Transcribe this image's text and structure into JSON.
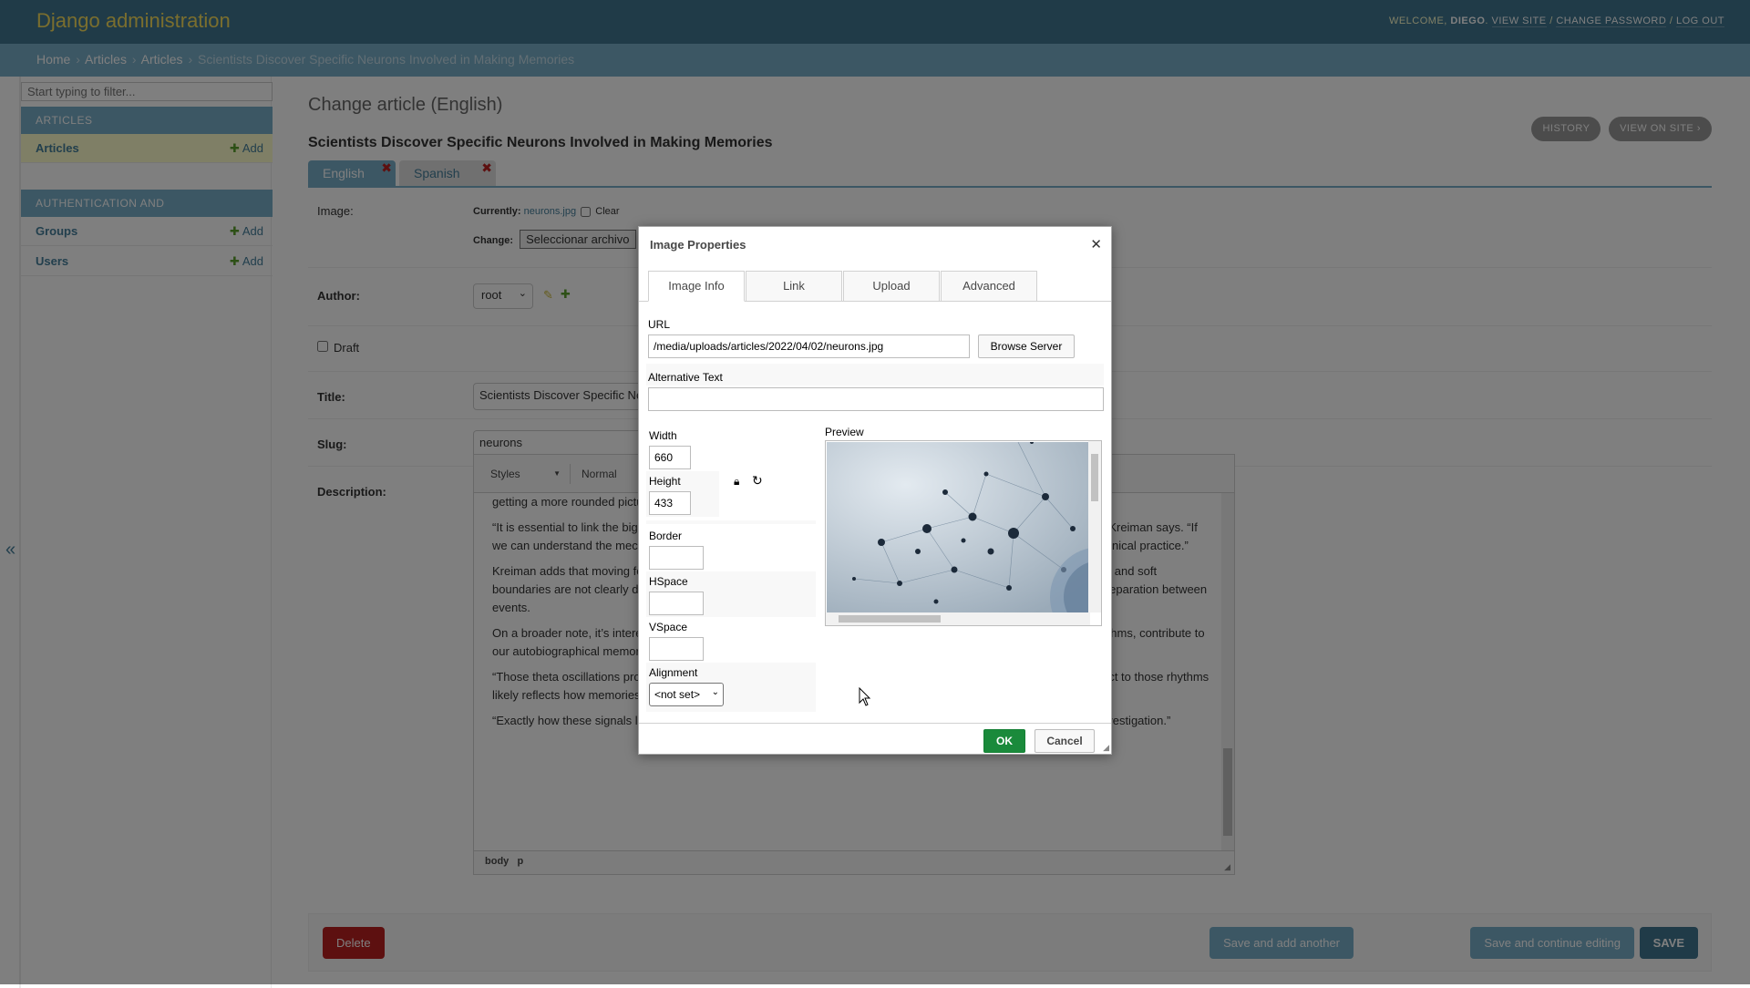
{
  "header": {
    "branding": "Django administration",
    "welcome": "Welcome,",
    "username": "Diego",
    "view_site": "View site",
    "change_password": "Change password",
    "log_out": "Log out",
    "sep": "/"
  },
  "breadcrumbs": [
    "Home",
    "Articles",
    "Articles",
    "Scientists Discover Specific Neurons Involved in Making Memories"
  ],
  "sidebar": {
    "filter_placeholder": "Start typing to filter...",
    "modules": [
      {
        "caption": "Articles",
        "items": [
          {
            "label": "Articles",
            "add": "Add"
          }
        ]
      },
      {
        "caption": "Authentication and Authorization",
        "items": [
          {
            "label": "Groups",
            "add": "Add"
          },
          {
            "label": "Users",
            "add": "Add"
          }
        ]
      }
    ],
    "toggle": "«"
  },
  "page": {
    "title": "Change article (English)",
    "object_title": "Scientists Discover Specific Neurons Involved in Making Memories",
    "history": "History",
    "view_on_site": "View on site",
    "tabs": [
      {
        "label": "English",
        "remove": "✖"
      },
      {
        "label": "Spanish",
        "remove": "✖"
      }
    ]
  },
  "form": {
    "image_label": "Image:",
    "currently": "Currently:",
    "current_file": "neurons.jpg",
    "clear": "Clear",
    "change": "Change:",
    "choose_file": "Seleccionar archivo",
    "author_label": "Author:",
    "author_value": "root",
    "draft_label": "Draft",
    "title_label": "Title:",
    "title_value": "Scientists Discover Specific Neurons Involved in Making Memories",
    "slug_label": "Slug:",
    "slug_value": "neurons",
    "description_label": "Description:"
  },
  "editor": {
    "styles": "Styles",
    "format": "Normal",
    "paragraphs": [
      "getting a more rounded picture of how memories are formed.",
      "“It is essential to link the big picture of memories with mechanisms that reveal what is happening at the cellular level,” Kreiman says. “If we can understand the mechanisms, we can hopefully help people with memory deficits, bridging neuroscience and clinical practice.”",
      "Kreiman adds that moving forward, it will be important to understand how memory works in other contexts, where hard and soft boundaries are not clearly delineated, and how the brain encodes them in a graded manner, indicating the degree of separation between events.",
      "On a broader note, it’s interesting to consider how these neural signals, particularly the hippocampal-cortical theta rhythms, contribute to our autobiographical memory and our sense of self.",
      "“Those theta oscillations provide a timing mechanism for neurons, and the way neurons adjust their activity with respect to those rhythms likely reflects how memories are organized in time,” Kreiman says.",
      "“Exactly how these signals lead to the notion of selfhood and autobiographical memories remains a topic for further investigation.”"
    ],
    "path": [
      "body",
      "p"
    ]
  },
  "submit": {
    "delete": "Delete",
    "save_add": "Save and add another",
    "save_continue": "Save and continue editing",
    "save": "SAVE"
  },
  "dialog": {
    "title": "Image Properties",
    "close": "✕",
    "tabs": [
      "Image Info",
      "Link",
      "Upload",
      "Advanced"
    ],
    "url_label": "URL",
    "url_value": "/media/uploads/articles/2022/04/02/neurons.jpg",
    "browse_server": "Browse Server",
    "alt_label": "Alternative Text",
    "alt_value": "",
    "width_label": "Width",
    "width_value": "660",
    "height_label": "Height",
    "height_value": "433",
    "border_label": "Border",
    "border_value": "",
    "hspace_label": "HSpace",
    "hspace_value": "",
    "vspace_label": "VSpace",
    "vspace_value": "",
    "alignment_label": "Alignment",
    "alignment_value": "<not set>",
    "preview_label": "Preview",
    "ok": "OK",
    "cancel": "Cancel"
  },
  "colors": {
    "header_bg": "#417690",
    "breadcrumbs_bg": "#79aec8",
    "branding": "#f5dd5d",
    "ok_button": "#1a8a3b",
    "delete_button": "#ba2121",
    "save_button": "#417690",
    "secondary_button": "#79aec8"
  }
}
